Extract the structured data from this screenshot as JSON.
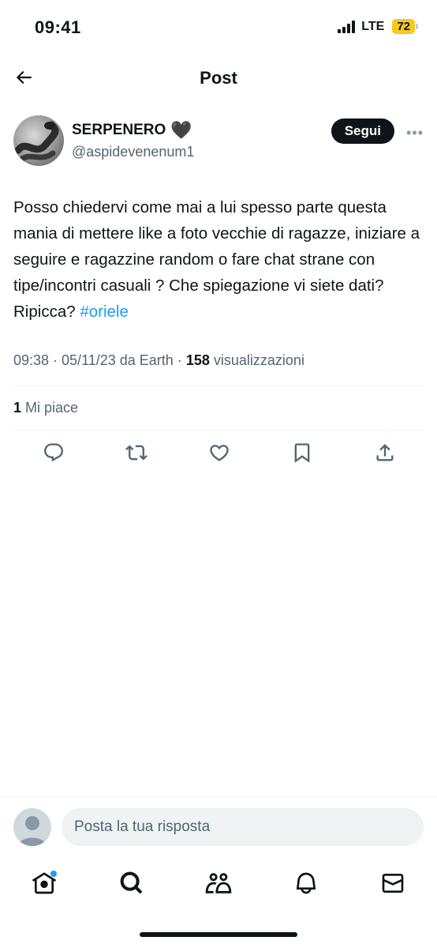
{
  "status_bar": {
    "time": "09:41",
    "network": "LTE",
    "battery": "72"
  },
  "header": {
    "title": "Post"
  },
  "post": {
    "author": {
      "display_name": "SERPENERO",
      "emoji": "🖤",
      "handle": "@aspidevenenum1",
      "follow_label": "Segui",
      "more_label": "•••"
    },
    "text": "Posso chiedervi come mai a lui spesso parte questa mania di mettere like a foto vecchie di ragazze, iniziare a seguire e ragazzine random o fare chat strane con tipe/incontri casuali ? Che spiegazione vi siete dati? Ripicca?",
    "hashtag": "#oriele",
    "meta": {
      "time_date": "09:38 · 05/11/23 da Earth ·",
      "views_count": "158",
      "views_label": "visualizzazioni"
    },
    "likes": {
      "count": "1",
      "label": "Mi piace"
    }
  },
  "actions": [
    "reply-icon",
    "retweet-icon",
    "like-icon",
    "bookmark-icon",
    "share-icon"
  ],
  "reply": {
    "placeholder": "Posta la tua risposta"
  },
  "bottom_nav": [
    "home-icon",
    "search-icon",
    "communities-icon",
    "notifications-icon",
    "messages-icon"
  ],
  "colors": {
    "accent": "#1d9bf0",
    "text": "#0f1419",
    "secondary": "#536471",
    "battery": "#f4c91d"
  }
}
